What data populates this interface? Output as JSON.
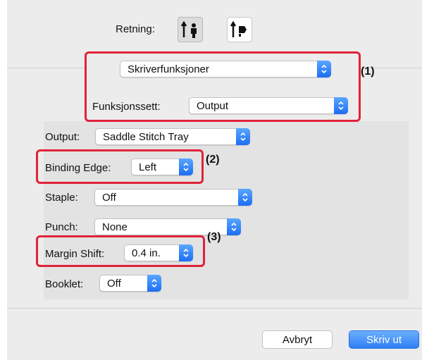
{
  "orientation": {
    "label": "Retning:",
    "options": [
      {
        "name": "portrait-orientation",
        "selected": true
      },
      {
        "name": "landscape-orientation",
        "selected": false
      }
    ]
  },
  "panel_select": {
    "value": "Skriverfunksjoner"
  },
  "feature_set": {
    "label": "Funksjonssett:",
    "value": "Output"
  },
  "output_settings": {
    "output": {
      "label": "Output:",
      "value": "Saddle Stitch Tray"
    },
    "binding_edge": {
      "label": "Binding Edge:",
      "value": "Left"
    },
    "staple": {
      "label": "Staple:",
      "value": "Off"
    },
    "punch": {
      "label": "Punch:",
      "value": "None"
    },
    "margin_shift": {
      "label": "Margin Shift:",
      "value": "0.4 in."
    },
    "booklet": {
      "label": "Booklet:",
      "value": "Off"
    }
  },
  "callouts": [
    "(1)",
    "(2)",
    "(3)"
  ],
  "buttons": {
    "cancel": "Avbryt",
    "print": "Skriv ut"
  },
  "colors": {
    "accent": "#2f7ef5",
    "highlight": "#e0233a",
    "dialog_bg": "#ececec"
  },
  "icons": {
    "popup_arrow": "chevron-updown-icon"
  }
}
